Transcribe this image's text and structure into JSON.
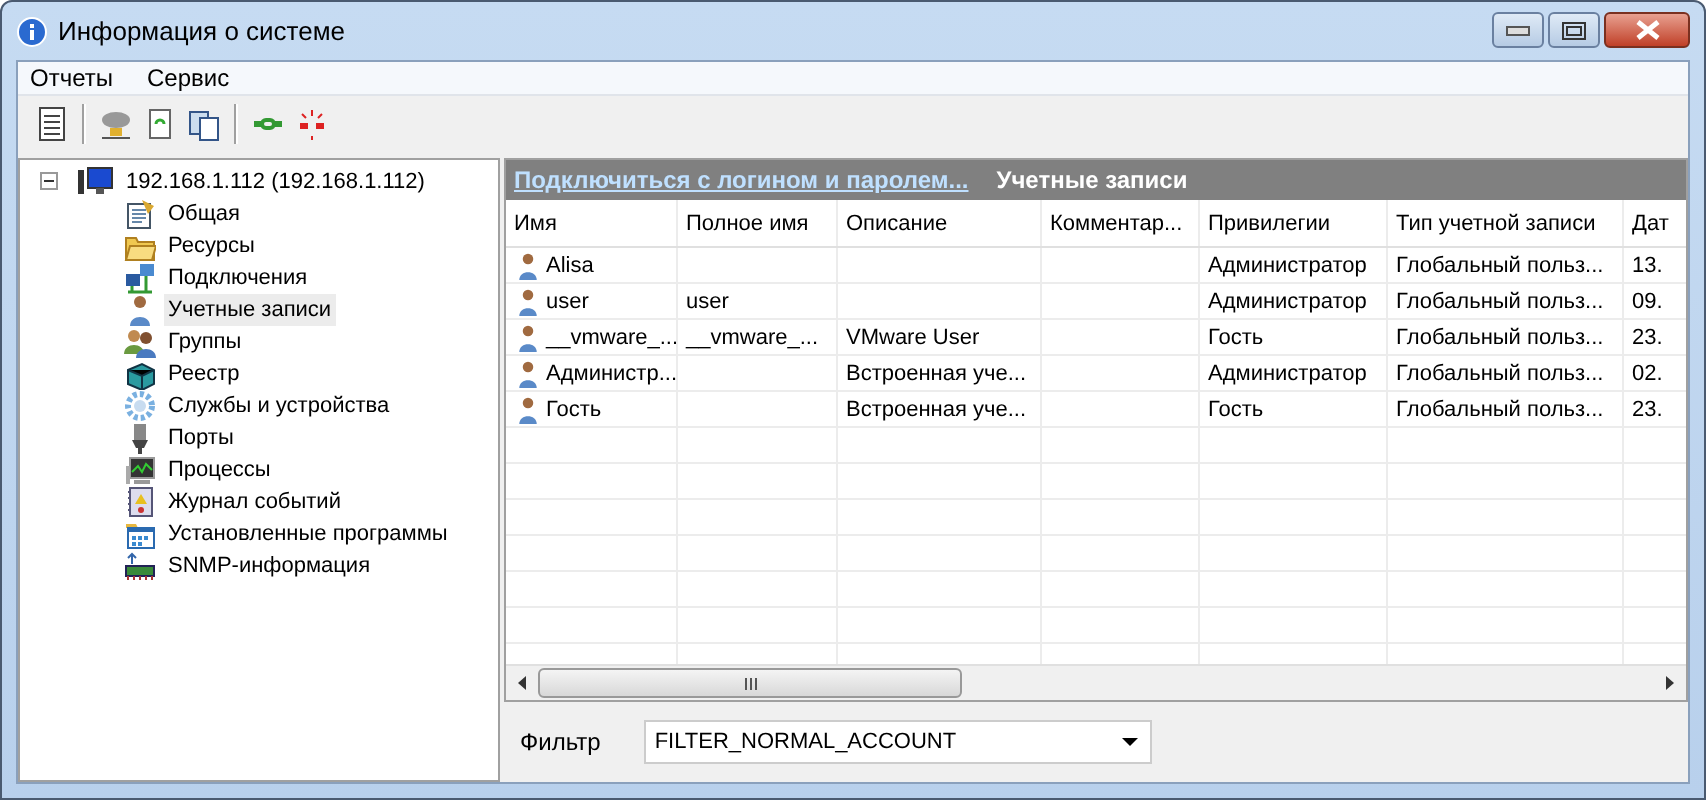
{
  "window": {
    "title": "Информация о системе"
  },
  "menu": [
    "Отчеты",
    "Сервис"
  ],
  "tree": {
    "label": "192.168.1.112 (192.168.1.112)",
    "expanded": true,
    "children": [
      {
        "label": "Общая",
        "selected": false
      },
      {
        "label": "Ресурсы",
        "selected": false
      },
      {
        "label": "Подключения",
        "selected": false
      },
      {
        "label": "Учетные записи",
        "selected": true
      },
      {
        "label": "Группы",
        "selected": false
      },
      {
        "label": "Реестр",
        "selected": false
      },
      {
        "label": "Службы и устройства",
        "selected": false
      },
      {
        "label": "Порты",
        "selected": false
      },
      {
        "label": "Процессы",
        "selected": false
      },
      {
        "label": "Журнал событий",
        "selected": false
      },
      {
        "label": "Установленные программы",
        "selected": false
      },
      {
        "label": "SNMP-информация",
        "selected": false
      }
    ]
  },
  "panel": {
    "link": "Подключиться с логином и паролем...",
    "title": "Учетные записи"
  },
  "table": {
    "columns": [
      "Имя",
      "Полное имя",
      "Описание",
      "Комментар...",
      "Привилегии",
      "Тип учетной записи",
      "Дат"
    ],
    "rows": [
      [
        "Alisa",
        "",
        "",
        "",
        "Администратор",
        "Глобальный польз...",
        "13."
      ],
      [
        "user",
        "user",
        "",
        "",
        "Администратор",
        "Глобальный польз...",
        "09."
      ],
      [
        "__vmware_...",
        "__vmware_...",
        "VMware User",
        "",
        "Гость",
        "Глобальный польз...",
        "23."
      ],
      [
        "Администр...",
        "",
        "Встроенная уче...",
        "",
        "Администратор",
        "Глобальный польз...",
        "02."
      ],
      [
        "Гость",
        "",
        "Встроенная уче...",
        "",
        "Гость",
        "Глобальный польз...",
        "23."
      ]
    ]
  },
  "filter": {
    "label": "Фильтр",
    "value": "FILTER_NORMAL_ACCOUNT"
  }
}
